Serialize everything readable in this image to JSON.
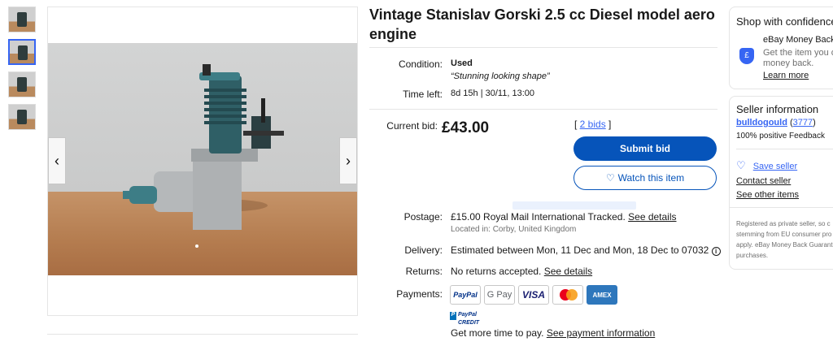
{
  "listing": {
    "title": "Vintage Stanislav Gorski 2.5 cc Diesel model aero engine"
  },
  "details": {
    "condition_label": "Condition:",
    "condition_value": "Used",
    "condition_quote": "“Stunning looking shape”",
    "time_label": "Time left:",
    "time_value": "8d 15h",
    "time_sep": "|",
    "time_end": "30/11, 13:00"
  },
  "bid": {
    "label": "Current bid:",
    "price": "£43.00",
    "bids_open": "[ ",
    "bids_link": "2 bids",
    "bids_close": " ]",
    "submit_label": "Submit bid",
    "watch_label": "Watch this item"
  },
  "shipping": {
    "postage_label": "Postage:",
    "postage_value": "£15.00 Royal Mail International Tracked.",
    "postage_link": "See details",
    "location": "Located in: Corby, United Kingdom",
    "delivery_label": "Delivery:",
    "delivery_value": "Estimated between Mon, 11 Dec and Mon, 18 Dec to 07032",
    "returns_label": "Returns:",
    "returns_value": "No returns accepted.",
    "returns_link": "See details",
    "payments_label": "Payments:"
  },
  "payments": {
    "paypal": "PayPal",
    "gpay": "G Pay",
    "visa": "VISA",
    "amex": "AMEX",
    "credit_line1": "PayPal",
    "credit_line2": "CREDIT",
    "credit_text": "Get more time to pay.",
    "credit_link": "See payment information"
  },
  "sidebar": {
    "shop_title": "Shop with confidence",
    "mbg_title": "eBay Money Back",
    "mbg_text_1": "Get the item you o",
    "mbg_text_2": "money back.",
    "learn_more": "Learn more",
    "seller_title": "Seller information",
    "seller_name": "bulldogould",
    "seller_score": "3777",
    "feedback": "100% positive Feedback",
    "save_seller": "Save seller",
    "contact_seller": "Contact seller",
    "see_other": "See other items",
    "note_1": "Registered as private seller, so c",
    "note_2": "stemming from EU consumer pro",
    "note_3": "apply. eBay Money Back Guarant",
    "note_4": "purchases."
  },
  "colors": {
    "primary": "#0654ba",
    "link": "#3665f3"
  }
}
